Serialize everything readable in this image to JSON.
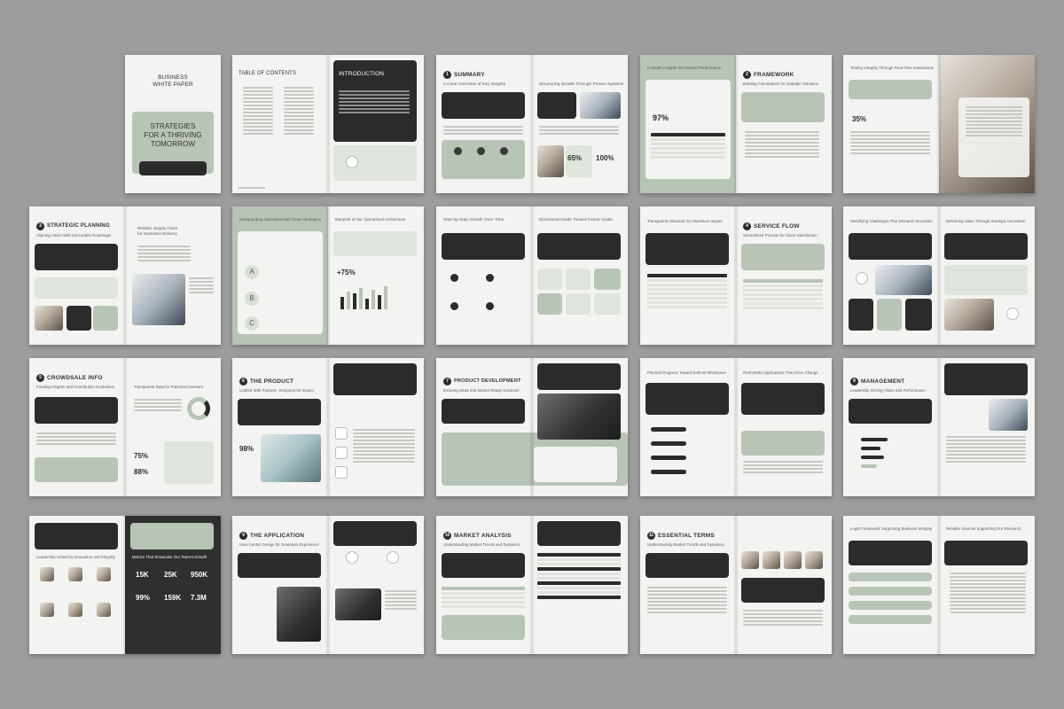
{
  "cover": {
    "title_line1": "BUSINESS",
    "title_line2": "WHITE PAPER",
    "headline_1": "STRATEGIES",
    "headline_2": "FOR A THRIVING",
    "headline_3": "TOMORROW"
  },
  "toc": {
    "title": "TABLE OF CONTENTS",
    "intro_title": "INTRODUCTION"
  },
  "summary": {
    "num": "1",
    "title": "SUMMARY",
    "subtitle": "A Clear Overview of Key Insights",
    "right_title": "Structuring Growth Through Proven Systems",
    "stat1": "65%",
    "stat2": "100%"
  },
  "framework": {
    "left_title": "In-Depth Insights Into Market Performance",
    "stat": "97%",
    "num": "2",
    "title": "FRAMEWORK",
    "subtitle": "Building Foundations for Scalable Solutions"
  },
  "testing": {
    "title": "Testing Integrity Through Real-Time Evaluations",
    "stat": "35%"
  },
  "strategic": {
    "num": "3",
    "title": "STRATEGIC PLANNING",
    "subtitle": "Aligning Vision With Executable Roadmaps",
    "right_title_1": "Reliable Supply Chain",
    "right_title_2": "for Seamless Delivery"
  },
  "operations": {
    "left_title": "Safeguarding Operations with Smart Strategies",
    "right_title": "Blueprint of Our Operational Architecture",
    "stat": "+75%",
    "letters": [
      "A",
      "B",
      "C"
    ]
  },
  "growth": {
    "left_title": "Step-by-Step Growth Over Time",
    "right_title": "Directional Guide Toward Future Goals"
  },
  "service": {
    "left_title": "Transparent Allocation for Maximum Impact",
    "num": "4",
    "title": "SERVICE FLOW",
    "subtitle": "Streamlined Process for Client Satisfaction"
  },
  "challenges": {
    "left_title": "Identifying Challenges That Demand Innovation",
    "right_title": "Delivering Value Through Strategic Innovation"
  },
  "crowdsale": {
    "num": "5",
    "title": "CROWDSALE INFO",
    "subtitle": "Funding Insights and Contribution Guidelines",
    "right_title": "Transparent Data for Potential Investors",
    "stat1": "75%",
    "stat2": "88%"
  },
  "product": {
    "num": "6",
    "title": "THE PRODUCT",
    "subtitle": "Crafted With Purpose, Designed for Impact",
    "stat": "98%"
  },
  "development": {
    "num": "7",
    "title": "PRODUCT DEVELOPMENT",
    "subtitle": "Evolving Ideas Into Market-Ready Solutions"
  },
  "milestones": {
    "left_title": "Planned Progress Toward Defined Milestones",
    "right_title": "Real-World Applications That Drive Change"
  },
  "management": {
    "num": "8",
    "title": "MANAGEMENT",
    "subtitle": "Leadership Driving Vision and Performance"
  },
  "team": {
    "left_title": "Leadership United by Innovation and Integrity",
    "right_title": "Metrics That Showcase Our Team's Growth",
    "metrics": [
      "15K",
      "25K",
      "950K",
      "99%",
      "159K",
      "7.3M"
    ]
  },
  "application": {
    "num": "9",
    "title": "THE APPLICATION",
    "subtitle": "User-Centric Design for Seamless Experience"
  },
  "market": {
    "num": "10",
    "title": "MARKET ANALYSIS",
    "subtitle": "Understanding Market Trends and Dynamics"
  },
  "terms": {
    "num": "11",
    "title": "ESSENTIAL TERMS",
    "subtitle": "Understanding Market Trends and Dynamics"
  },
  "legal": {
    "left_title": "Legal Framework Supporting Business Integrity",
    "right_title": "Reliable Sources Supporting Our Research"
  },
  "colors": {
    "background": "#9c9d9c",
    "dark": "#2b2b2b",
    "sage": "#b8c4b5",
    "paper": "#f3f3f1"
  }
}
